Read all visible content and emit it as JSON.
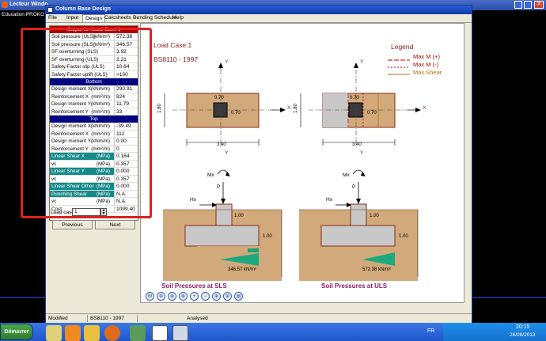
{
  "outer_window": {
    "title": "Lecteur Windo",
    "company": "Education PROKO"
  },
  "app": {
    "title": "Column Base Design"
  },
  "menu": [
    "File",
    "Input",
    "Design",
    "Calcsheets",
    "Bending Schedule",
    "Help"
  ],
  "panel": {
    "title": "Output for Load Case 1",
    "rows": [
      {
        "label": "Soil pressure (ULS)",
        "unit": "(kN/m²)",
        "value": "572.38"
      },
      {
        "label": "Soil pressure (SLS)",
        "unit": "(kN/m²)",
        "value": "346.57"
      },
      {
        "label": "SF overturning (SLS)",
        "unit": "",
        "value": "3.92"
      },
      {
        "label": "SF overturning (ULS)",
        "unit": "",
        "value": "2.21"
      },
      {
        "label": "Safety Factor slip (ULS)",
        "unit": "",
        "value": "10.64"
      },
      {
        "label": "Safety Factor uplift (ULS)",
        "unit": "",
        "value": ">100"
      }
    ],
    "bottom_header": "Bottom",
    "bottom_rows": [
      {
        "label": "Design moment X",
        "unit": "(kNm/m)",
        "value": "290.91"
      },
      {
        "label": "Reinforcement X",
        "unit": "(mm²/m)",
        "value": "824"
      },
      {
        "label": "Design moment Y",
        "unit": "(kNm/m)",
        "value": "11.79"
      },
      {
        "label": "Reinforcement Y",
        "unit": "(mm²/m)",
        "value": "33"
      }
    ],
    "top_header": "Top",
    "top_rows": [
      {
        "label": "Design moment X",
        "unit": "(kNm/m)",
        "value": "-39.49"
      },
      {
        "label": "Reinforcement X",
        "unit": "(mm²/m)",
        "value": "112"
      },
      {
        "label": "Design moment Y",
        "unit": "(kNm/m)",
        "value": "0.00"
      },
      {
        "label": "Reinforcement Y",
        "unit": "(mm²/m)",
        "value": "0"
      }
    ],
    "shear_rows": [
      {
        "label": "Linear Shear X",
        "unit": "(MPa)",
        "value": "0.184",
        "highlight": true
      },
      {
        "label": "vc",
        "unit": "(MPa)",
        "value": "0.357",
        "highlight": false
      },
      {
        "label": "Linear Shear Y",
        "unit": "(MPa)",
        "value": "0.000",
        "highlight": true
      },
      {
        "label": "vc",
        "unit": "(MPa)",
        "value": "0.357",
        "highlight": false
      },
      {
        "label": "Linear Shear Other",
        "unit": "(MPa)",
        "value": "0.000",
        "highlight": true
      },
      {
        "label": "Punching Shear",
        "unit": "(MPa)",
        "value": "N.A.",
        "highlight": true
      },
      {
        "label": "vc",
        "unit": "(MPa)",
        "value": "N.A.",
        "highlight": false
      },
      {
        "label": "Cost",
        "unit": "",
        "value": "1099.40",
        "highlight": false
      }
    ],
    "load_case_label": "Load case",
    "load_case_value": "1",
    "previous": "Previous",
    "next": "Next"
  },
  "drawing": {
    "load_case": "Load Case:1",
    "code": "BS8110 - 1997",
    "legend_title": "Legend",
    "legend": [
      {
        "label": "Max M (+)",
        "color": "#c00000",
        "dash": "6,2"
      },
      {
        "label": "Max M (-)",
        "color": "#c00000",
        "dash": "2,2"
      },
      {
        "label": "Max Shear",
        "color": "#b07010",
        "dash": ""
      }
    ],
    "dim_070": "0.70",
    "dim_340": "3.40",
    "dim_180": "1.80",
    "axis_x": "X",
    "axis_y": "Y",
    "label_mx": "Mx",
    "label_p": "P",
    "label_hx": "Hx",
    "dim_100": "1.00",
    "sls_pressure": "346.57 kN/m²",
    "uls_pressure": "572.38 kN/m²",
    "sls_title": "Soil Pressures at SLS",
    "uls_title": "Soil Pressures at ULS"
  },
  "statusbar": {
    "modified": "Modified",
    "code": "BS8110 - 1997",
    "analysed": "Analysed"
  },
  "taskbar": {
    "start": "Démarrer",
    "lang": "FR",
    "time": "20:15",
    "date": "26/08/2013"
  },
  "colors": {
    "soil": "#d2a97a",
    "footing": "#c8c8c8",
    "accent": "#e0201f",
    "xpblue": "#2458cf"
  }
}
